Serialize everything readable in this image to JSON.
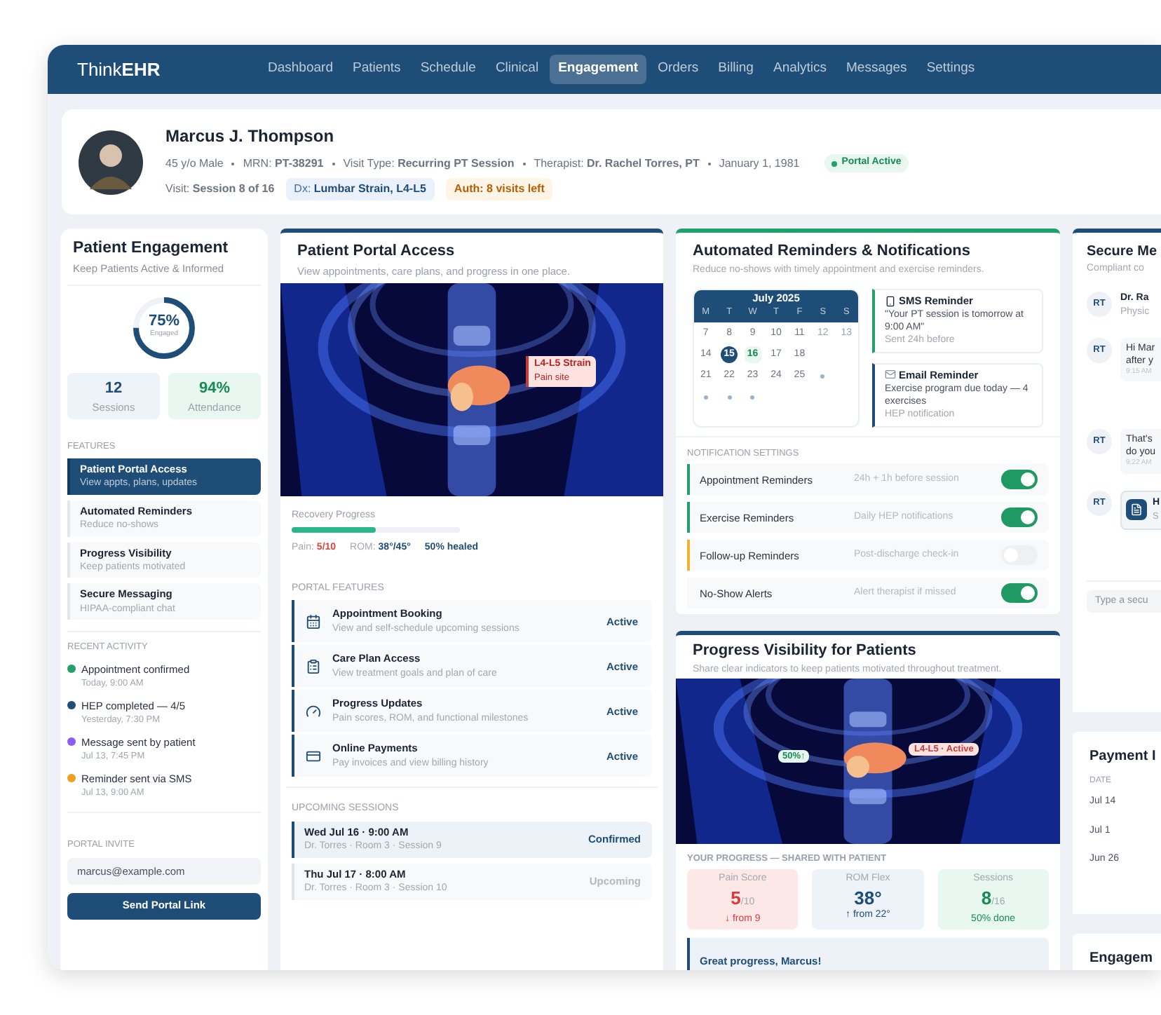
{
  "logo": {
    "light": "Think",
    "bold": "EHR"
  },
  "nav": [
    {
      "label": "Dashboard",
      "selected": false
    },
    {
      "label": "Patients",
      "selected": false
    },
    {
      "label": "Schedule",
      "selected": false
    },
    {
      "label": "Clinical",
      "selected": false
    },
    {
      "label": "Engagement",
      "selected": true
    },
    {
      "label": "Orders",
      "selected": false
    },
    {
      "label": "Billing",
      "selected": false
    },
    {
      "label": "Analytics",
      "selected": false
    },
    {
      "label": "Messages",
      "selected": false
    },
    {
      "label": "Settings",
      "selected": false
    }
  ],
  "patient": {
    "name": "Marcus J. Thompson",
    "details": [
      "45 y/o Male",
      "MRN: **PT-38291**",
      "Visit Type: **Recurring PT Session**",
      "Therapist: **Dr. Rachel Torres, PT**",
      "January 1, 1981"
    ],
    "status": "Portal Active",
    "visit": "Visit: **Session 8 of 16**",
    "dx_label": "Dx:",
    "dx_value": "Lumbar Strain, L4-L5",
    "auth": "Auth: 8 visits left"
  },
  "engagement": {
    "title": "Patient Engagement",
    "subtitle": "Keep Patients Active & Informed",
    "ring_value": "75%",
    "ring_label": "Engaged",
    "level": 0.75,
    "stats": [
      {
        "value": "12",
        "label": "Sessions",
        "kind": "info"
      },
      {
        "value": "94%",
        "label": "Attendance",
        "kind": "success"
      }
    ],
    "features_label": "FEATURES",
    "features": [
      {
        "title": "Patient Portal Access",
        "desc": "View appts, plans, updates",
        "selected": true
      },
      {
        "title": "Automated Reminders",
        "desc": "Reduce no-shows",
        "selected": false
      },
      {
        "title": "Progress Visibility",
        "desc": "Keep patients motivated",
        "selected": false
      },
      {
        "title": "Secure Messaging",
        "desc": "HIPAA-compliant chat",
        "selected": false
      }
    ],
    "activity_label": "RECENT ACTIVITY",
    "activity": [
      {
        "text": "Appointment confirmed",
        "time": "Today, 9:00 AM",
        "color": "#22a06b"
      },
      {
        "text": "HEP completed — 4/5",
        "time": "Yesterday, 7:30 PM",
        "color": "#1e4d78"
      },
      {
        "text": "Message sent by patient",
        "time": "Jul 13, 7:45 PM",
        "color": "#8b5cf6"
      },
      {
        "text": "Reminder sent via SMS",
        "time": "Jul 13, 9:00 AM",
        "color": "#f0a020"
      }
    ],
    "invite_label": "PORTAL INVITE",
    "invite_value": "marcus@example.com",
    "invite_button": "Send Portal Link"
  },
  "portal": {
    "title": "Patient Portal Access",
    "subtitle": "View appointments, care plans, and progress in one place.",
    "tag_title": "L4-L5 Strain",
    "tag_sub": "Pain site",
    "recovery_label": "Recovery Progress",
    "level": 0.5,
    "metrics": [
      {
        "label": "Pain:",
        "value": "5/10",
        "kind": "alert"
      },
      {
        "label": "ROM:",
        "value": "38°/45°",
        "kind": "info"
      },
      {
        "value": "50% healed",
        "kind": "info"
      }
    ],
    "features_label": "PORTAL FEATURES",
    "features": [
      {
        "title": "Appointment Booking",
        "desc": "View and self-schedule upcoming sessions",
        "status": "Active",
        "kind": "calendar"
      },
      {
        "title": "Care Plan Access",
        "desc": "View treatment goals and plan of care",
        "status": "Active",
        "kind": "plan"
      },
      {
        "title": "Progress Updates",
        "desc": "Pain scores, ROM, and functional milestones",
        "status": "Active",
        "kind": "progress"
      },
      {
        "title": "Online Payments",
        "desc": "Pay invoices and view billing history",
        "status": "Active",
        "kind": "payment"
      }
    ],
    "sessions_label": "UPCOMING SESSIONS",
    "sessions": [
      {
        "title": "Wed Jul 16 · 9:00 AM",
        "detail": "Dr. Torres · Room 3 · Session 9",
        "status": "Confirmed",
        "confirmed": true
      },
      {
        "title": "Thu Jul 17 · 8:00 AM",
        "detail": "Dr. Torres · Room 3 · Session 10",
        "status": "Upcoming",
        "confirmed": false
      }
    ]
  },
  "reminders": {
    "title": "Automated Reminders & Notifications",
    "subtitle": "Reduce no-shows with timely appointment and exercise reminders.",
    "calendar": {
      "month": "July 2025",
      "weekdays": [
        "M",
        "T",
        "W",
        "T",
        "F",
        "S",
        "S"
      ],
      "cells": [
        {
          "label": "7",
          "kind": "day"
        },
        {
          "label": "8",
          "kind": "day"
        },
        {
          "label": "9",
          "kind": "day"
        },
        {
          "label": "10",
          "kind": "day"
        },
        {
          "label": "11",
          "kind": "day"
        },
        {
          "label": "12",
          "kind": "weekend"
        },
        {
          "label": "13",
          "kind": "weekend"
        },
        {
          "label": "14",
          "kind": "day"
        },
        {
          "label": "15",
          "kind": "selected"
        },
        {
          "label": "16",
          "kind": "today"
        },
        {
          "label": "17",
          "kind": "day"
        },
        {
          "label": "18",
          "kind": "day"
        },
        {
          "kind": "empty"
        },
        {
          "kind": "empty"
        },
        {
          "label": "21",
          "kind": "day"
        },
        {
          "label": "22",
          "kind": "day"
        },
        {
          "label": "23",
          "kind": "day"
        },
        {
          "label": "24",
          "kind": "day"
        },
        {
          "label": "25",
          "kind": "day"
        },
        {
          "kind": "dot"
        },
        {
          "kind": "empty"
        },
        {
          "kind": "dot"
        },
        {
          "kind": "dot"
        },
        {
          "kind": "dot"
        }
      ]
    },
    "cards": [
      {
        "title": "SMS Reminder",
        "body": "\"Your PT session is tomorrow at 9:00 AM\"",
        "note": "Sent 24h before",
        "kind": "sms"
      },
      {
        "title": "Email Reminder",
        "body": "Exercise program due today — 4 exercises",
        "note": "HEP notification",
        "kind": "email"
      }
    ],
    "settings_label": "NOTIFICATION SETTINGS",
    "settings": [
      {
        "label": "Appointment Reminders",
        "desc": "24h + 1h before session",
        "on": true,
        "color": "#22a06b"
      },
      {
        "label": "Exercise Reminders",
        "desc": "Daily HEP notifications",
        "on": true,
        "color": "#22a06b"
      },
      {
        "label": "Follow-up Reminders",
        "desc": "Post-discharge check-in",
        "on": false,
        "color": "#f0b429"
      },
      {
        "label": "No-Show Alerts",
        "desc": "Alert therapist if missed",
        "on": true
      }
    ]
  },
  "progress": {
    "title": "Progress Visibility for Patients",
    "subtitle": "Share clear indicators to keep patients motivated throughout treatment.",
    "tag_left": "50%↑",
    "tag_right": "L4-L5 · Active",
    "label": "YOUR PROGRESS — SHARED WITH PATIENT",
    "stats": [
      {
        "label": "Pain Score",
        "value": "5",
        "unit": "/10",
        "change": "↓ from 9",
        "kind": "alert"
      },
      {
        "label": "ROM Flex",
        "value": "38°",
        "change": "↑ from 22°",
        "kind": "info"
      },
      {
        "label": "Sessions",
        "value": "8",
        "unit": "/16",
        "change": "50% done",
        "kind": "success"
      }
    ],
    "message_title": "Great progress, Marcus!"
  },
  "messaging": {
    "title": "Secure Me",
    "subtitle": "Compliant co",
    "items": [
      {
        "kind": "contact",
        "avatar": "RT",
        "name": "Dr. Ra",
        "role": "Physic"
      },
      {
        "kind": "message",
        "avatar": "RT",
        "lines": [
          "Hi Mar",
          "after y"
        ],
        "time": "9:15 AM"
      },
      {
        "kind": "message",
        "avatar": "RT",
        "lines": [
          "That's",
          "do you"
        ],
        "time": "9:22 AM"
      },
      {
        "kind": "file",
        "avatar": "RT",
        "name": "H",
        "role": "S"
      }
    ],
    "placeholder": "Type a secu"
  },
  "payment": {
    "title": "Payment I",
    "column": "DATE",
    "rows": [
      "Jul 14",
      "Jul 1",
      "Jun 26"
    ]
  },
  "engagement_card": {
    "title": "Engagem"
  }
}
